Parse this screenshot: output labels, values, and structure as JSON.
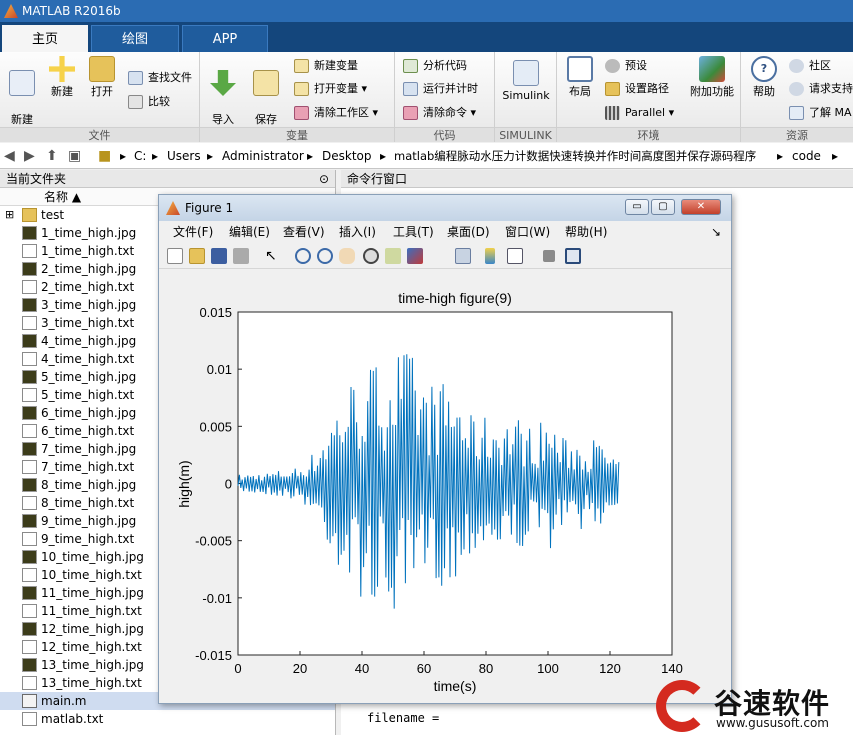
{
  "window": {
    "title": "MATLAB R2016b"
  },
  "tabs": [
    {
      "label": "主页"
    },
    {
      "label": "绘图"
    },
    {
      "label": "APP"
    }
  ],
  "ribbon": {
    "file_group": {
      "label": "文件",
      "new_script": "新建\n脚本",
      "new": "新建",
      "open": "打开",
      "find_files": "查找文件",
      "compare": "比较"
    },
    "var_group": {
      "label": "变量",
      "import": "导入\n数据",
      "save_ws": "保存\n工作区",
      "new_var": "新建变量",
      "open_var": "打开变量",
      "clear_ws": "清除工作区"
    },
    "code_group": {
      "label": "代码",
      "analyze": "分析代码",
      "run_time": "运行并计时",
      "clear_cmd": "清除命令"
    },
    "simulink_group": {
      "label": "SIMULINK",
      "simulink": "Simulink"
    },
    "env_group": {
      "label": "环境",
      "layout": "布局",
      "prefs": "预设",
      "set_path": "设置路径",
      "parallel": "Parallel",
      "addons": "附加功能"
    },
    "res_group": {
      "label": "资源",
      "help": "帮助",
      "community": "社区",
      "support": "请求支持",
      "learn": "了解 MA"
    }
  },
  "address": {
    "crumbs": [
      "C:",
      "Users",
      "Administrator",
      "Desktop",
      "matlab编程脉动水压力计数据快速转换并作时间高度图并保存源码程序",
      "code"
    ]
  },
  "file_panel": {
    "title": "当前文件夹",
    "col_name": "名称 ▲",
    "files": [
      {
        "name": "test",
        "type": "folder"
      },
      {
        "name": "1_time_high.jpg",
        "type": "jpg"
      },
      {
        "name": "1_time_high.txt",
        "type": "txt"
      },
      {
        "name": "2_time_high.jpg",
        "type": "jpg"
      },
      {
        "name": "2_time_high.txt",
        "type": "txt"
      },
      {
        "name": "3_time_high.jpg",
        "type": "jpg"
      },
      {
        "name": "3_time_high.txt",
        "type": "txt"
      },
      {
        "name": "4_time_high.jpg",
        "type": "jpg"
      },
      {
        "name": "4_time_high.txt",
        "type": "txt"
      },
      {
        "name": "5_time_high.jpg",
        "type": "jpg"
      },
      {
        "name": "5_time_high.txt",
        "type": "txt"
      },
      {
        "name": "6_time_high.jpg",
        "type": "jpg"
      },
      {
        "name": "6_time_high.txt",
        "type": "txt"
      },
      {
        "name": "7_time_high.jpg",
        "type": "jpg"
      },
      {
        "name": "7_time_high.txt",
        "type": "txt"
      },
      {
        "name": "8_time_high.jpg",
        "type": "jpg"
      },
      {
        "name": "8_time_high.txt",
        "type": "txt"
      },
      {
        "name": "9_time_high.jpg",
        "type": "jpg"
      },
      {
        "name": "9_time_high.txt",
        "type": "txt"
      },
      {
        "name": "10_time_high.jpg",
        "type": "jpg"
      },
      {
        "name": "10_time_high.txt",
        "type": "txt"
      },
      {
        "name": "11_time_high.jpg",
        "type": "jpg"
      },
      {
        "name": "11_time_high.txt",
        "type": "txt"
      },
      {
        "name": "12_time_high.jpg",
        "type": "jpg"
      },
      {
        "name": "12_time_high.txt",
        "type": "txt"
      },
      {
        "name": "13_time_high.jpg",
        "type": "jpg"
      },
      {
        "name": "13_time_high.txt",
        "type": "txt"
      },
      {
        "name": "main.m",
        "type": "m",
        "selected": true
      },
      {
        "name": "matlab.txt",
        "type": "txt"
      }
    ]
  },
  "command_window": {
    "title": "命令行窗口",
    "line": "filename ="
  },
  "figure": {
    "title": "Figure 1",
    "menu": [
      "文件(F)",
      "编辑(E)",
      "查看(V)",
      "插入(I)",
      "工具(T)",
      "桌面(D)",
      "窗口(W)",
      "帮助(H)"
    ],
    "btn_min": "▭",
    "btn_max": "▢",
    "btn_close": "✕"
  },
  "chart_data": {
    "type": "line",
    "title": "time-high figure(9)",
    "xlabel": "time(s)",
    "ylabel": "high(m)",
    "xlim": [
      0,
      140
    ],
    "ylim": [
      -0.015,
      0.015
    ],
    "xticks": [
      0,
      20,
      40,
      60,
      80,
      100,
      120,
      140
    ],
    "yticks": [
      0.015,
      0.01,
      0.005,
      0,
      -0.005,
      -0.01,
      -0.015
    ],
    "ytick_labels": [
      "0.015",
      "0.01",
      "0.005",
      "0",
      "-0.005",
      "-0.01",
      "-0.015"
    ],
    "series_color": "#0072bd",
    "envelope": [
      [
        0,
        0.0008
      ],
      [
        10,
        0.001
      ],
      [
        20,
        0.0015
      ],
      [
        25,
        0.003
      ],
      [
        30,
        0.006
      ],
      [
        35,
        0.009
      ],
      [
        40,
        0.01
      ],
      [
        45,
        0.011
      ],
      [
        50,
        0.012
      ],
      [
        55,
        0.012
      ],
      [
        60,
        0.009
      ],
      [
        65,
        0.009
      ],
      [
        70,
        0.009
      ],
      [
        75,
        0.006
      ],
      [
        80,
        0.006
      ],
      [
        85,
        0.006
      ],
      [
        90,
        0.006
      ],
      [
        95,
        0.005
      ],
      [
        100,
        0.006
      ],
      [
        105,
        0.004
      ],
      [
        110,
        0.004
      ],
      [
        115,
        0.004
      ],
      [
        120,
        0.003
      ],
      [
        123,
        0.002
      ]
    ]
  },
  "watermark": {
    "text": "谷速软件",
    "url": "www.gususoft.com"
  },
  "colors": {
    "accent": "#2b6cb3",
    "tabbar": "#14467c",
    "plotline": "#0072bd"
  }
}
